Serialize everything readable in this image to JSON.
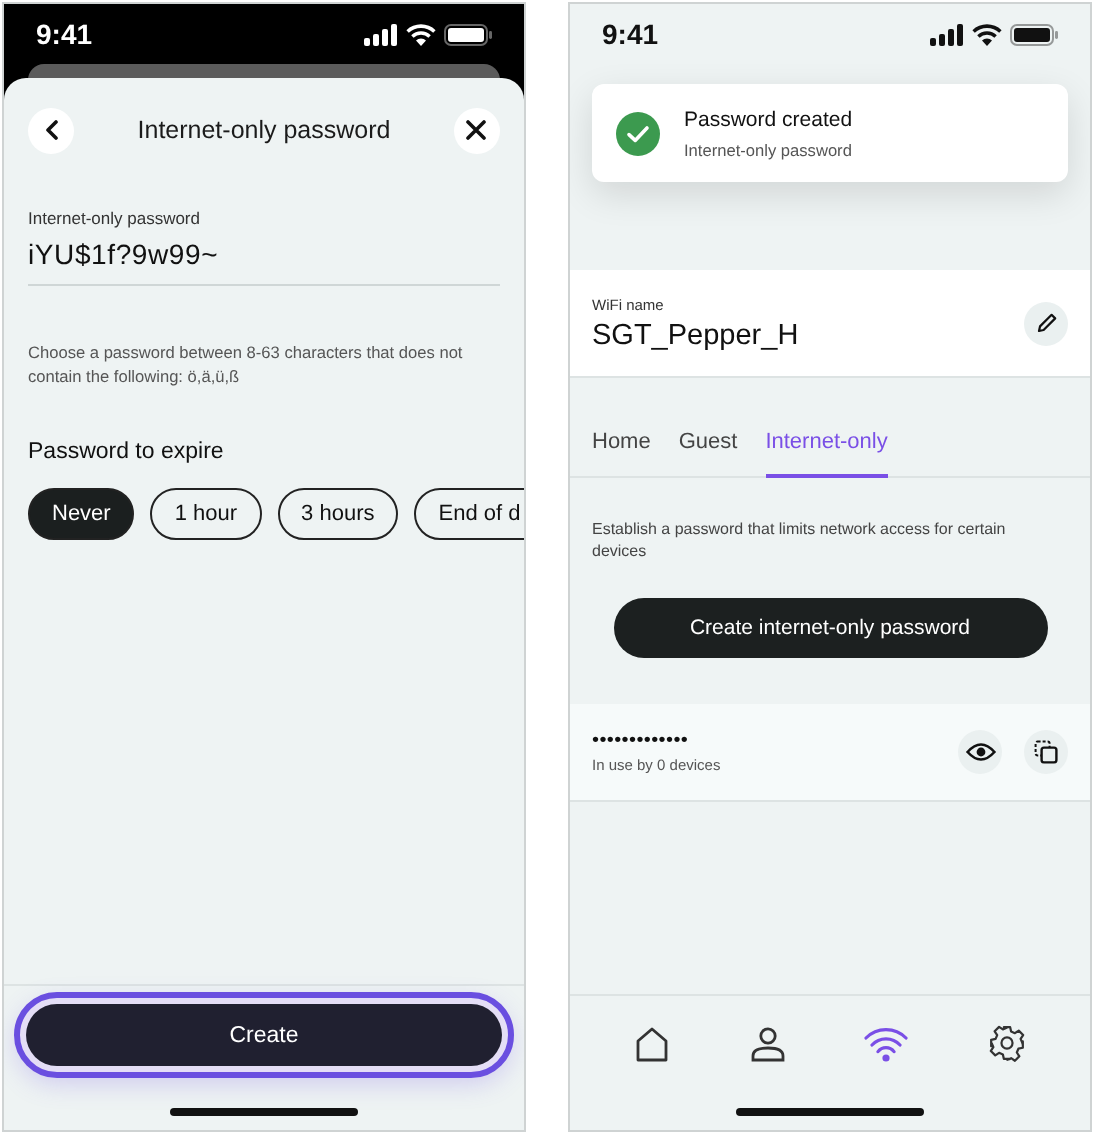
{
  "left_screen": {
    "status_bar": {
      "time": "9:41"
    },
    "header": {
      "title": "Internet-only password"
    },
    "password_field": {
      "label": "Internet-only password",
      "value": "iYU$1f?9w99~"
    },
    "hint": "Choose a password between 8-63 characters that does not contain the following: ö,ä,ü,ß",
    "expire": {
      "heading": "Password to expire",
      "options": [
        {
          "label": "Never",
          "selected": true
        },
        {
          "label": "1 hour",
          "selected": false
        },
        {
          "label": "3 hours",
          "selected": false
        },
        {
          "label": "End of d",
          "selected": false
        }
      ]
    },
    "create_button": {
      "label": "Create",
      "focused": true
    }
  },
  "right_screen": {
    "status_bar": {
      "time": "9:41"
    },
    "toast": {
      "title": "Password created",
      "subtitle": "Internet-only password"
    },
    "wifi": {
      "label": "WiFi name",
      "value": "SGT_Pepper_H"
    },
    "tabs": [
      {
        "label": "Home",
        "selected": false
      },
      {
        "label": "Guest",
        "selected": false
      },
      {
        "label": "Internet-only",
        "selected": true
      }
    ],
    "description": "Establish a password that limits network access for certain devices",
    "create_button": {
      "label": "Create internet-only password"
    },
    "password_entry": {
      "masked": "•••••••••••••",
      "usage": "In use by 0 devices"
    },
    "nav_items": [
      {
        "kind": "home",
        "selected": false
      },
      {
        "kind": "profile",
        "selected": false
      },
      {
        "kind": "wifi",
        "selected": true
      },
      {
        "kind": "settings",
        "selected": false
      }
    ]
  }
}
